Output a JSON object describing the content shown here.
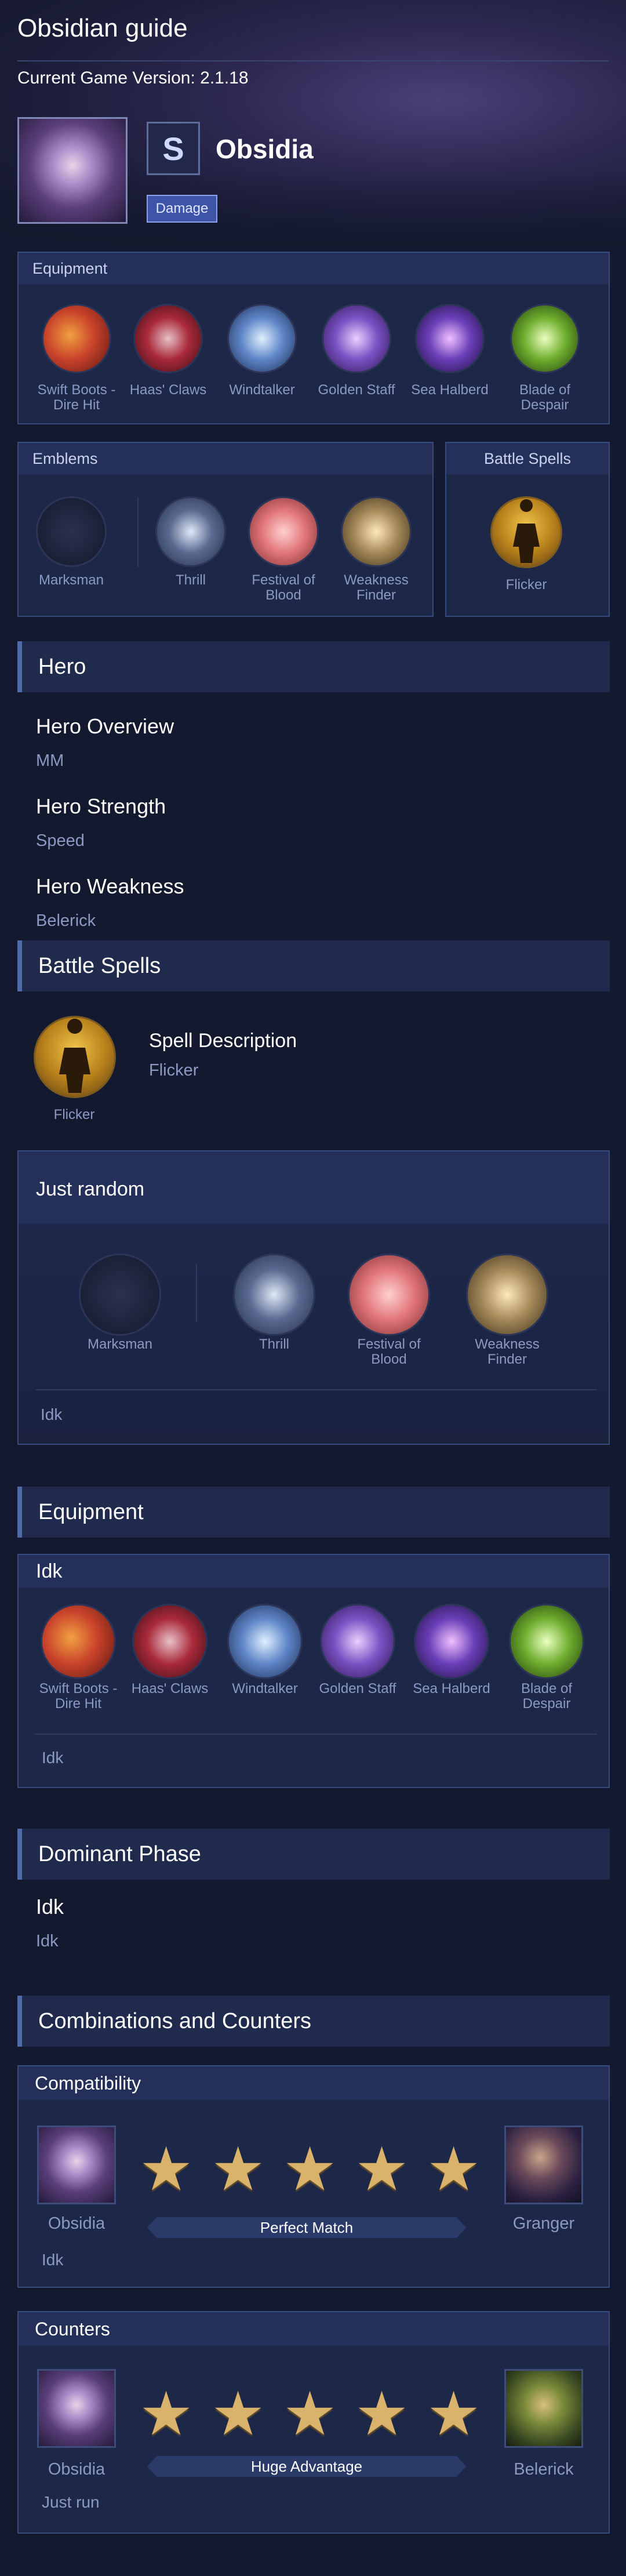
{
  "page": {
    "title": "Obsidian guide",
    "version": "Current Game Version: 2.1.18",
    "hero_name": "Obsidia",
    "role_badge": "Damage",
    "role_icon": "S"
  },
  "top_equipment": {
    "header": "Equipment",
    "items": [
      {
        "label": "Swift Boots - Dire Hit",
        "color": "#c9432b"
      },
      {
        "label": "Haas' Claws",
        "color": "#a92a3a"
      },
      {
        "label": "Windtalker",
        "color": "#5f86c8"
      },
      {
        "label": "Golden Staff",
        "color": "#7b52c4"
      },
      {
        "label": "Sea Halberd",
        "color": "#6a3fb8"
      },
      {
        "label": "Blade of Despair",
        "color": "#6fae2f"
      }
    ]
  },
  "top_emblems": {
    "header": "Emblems",
    "items": [
      {
        "label": "Marksman",
        "color": "#202840"
      },
      {
        "label": "Thrill",
        "color": "#344a72"
      },
      {
        "label": "Festival of Blood",
        "color": "#e2777b"
      },
      {
        "label": "Weakness Finder",
        "color": "#a58a5a"
      }
    ]
  },
  "top_spells": {
    "header": "Battle Spells",
    "spell_label": "Flicker"
  },
  "hero_section": {
    "header": "Hero",
    "overview_title": "Hero Overview",
    "overview_value": "MM",
    "strength_title": "Hero Strength",
    "strength_value": "Speed",
    "weakness_title": "Hero Weakness",
    "weakness_value": "Belerick"
  },
  "spells_section": {
    "header": "Battle Spells",
    "spell_label": "Flicker",
    "desc_title": "Spell Description",
    "desc_value": "Flicker"
  },
  "emblem_section": {
    "header": "Just random",
    "items": [
      "Marksman",
      "Thrill",
      "Festival of Blood",
      "Weakness Finder"
    ],
    "note": "Idk"
  },
  "equipment_section": {
    "header": "Equipment",
    "subheader": "Idk",
    "items": [
      "Swift Boots - Dire Hit",
      "Haas' Claws",
      "Windtalker",
      "Golden Staff",
      "Sea Halberd",
      "Blade of Despair"
    ],
    "note": "Idk"
  },
  "phase_section": {
    "header": "Dominant Phase",
    "title": "Idk",
    "value": "Idk"
  },
  "combos_section": {
    "header": "Combinations and Counters",
    "compat": {
      "header": "Compatibility",
      "left_hero": "Obsidia",
      "right_hero": "Granger",
      "rating": 5,
      "verdict": "Perfect Match",
      "note": "Idk"
    },
    "counters": {
      "header": "Counters",
      "left_hero": "Obsidia",
      "right_hero": "Belerick",
      "rating": 5,
      "verdict": "Huge Advantage",
      "note": "Just run"
    }
  }
}
